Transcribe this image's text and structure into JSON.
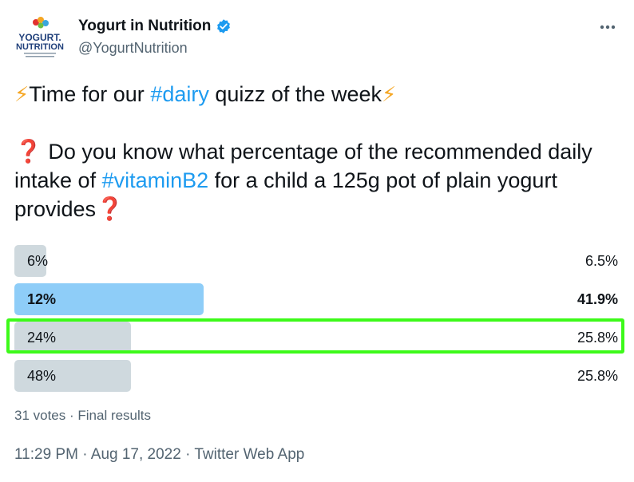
{
  "author": {
    "name": "Yogurt in Nutrition",
    "handle": "@YogurtNutrition",
    "avatar_line1": "YOGURT.",
    "avatar_line2": "NUTRITION",
    "avatar_tagline": "NUTRITION FOR SUSTAINABLE AND BALANCED DIETS",
    "verified_icon": "verified-badge-icon",
    "brand_color": "#1d9bf0"
  },
  "more_icon": "more-horizontal-icon",
  "tweet": {
    "line1_emoji_start": "⚡",
    "line1_text_a": "Time for our ",
    "line1_hashtag": "#dairy",
    "line1_text_b": " quizz of the week",
    "line1_emoji_end": "⚡",
    "line2_emoji": "❓",
    "line2_text_a": " Do you know what percentage of the recommended daily intake of ",
    "line2_hashtag": "#vitaminB2",
    "line2_text_b": " for a child a 125g pot of plain yogurt provides",
    "line2_emoji_end": "❓"
  },
  "poll": {
    "options": [
      {
        "label": "6%",
        "percent_text": "6.5%",
        "percent": 6.5,
        "winner": false
      },
      {
        "label": "12%",
        "percent_text": "41.9%",
        "percent": 41.9,
        "winner": true
      },
      {
        "label": "24%",
        "percent_text": "25.8%",
        "percent": 25.8,
        "winner": false
      },
      {
        "label": "48%",
        "percent_text": "25.8%",
        "percent": 25.8,
        "winner": false
      }
    ],
    "votes": "31 votes",
    "separator": " · ",
    "status": "Final results",
    "bar_color": "#cfd9de",
    "winner_color": "#8ecdf8",
    "highlight_color": "#3dfa1a"
  },
  "meta": {
    "time": "11:29 PM",
    "date": "Aug 17, 2022",
    "source": "Twitter Web App",
    "separator": " · "
  }
}
